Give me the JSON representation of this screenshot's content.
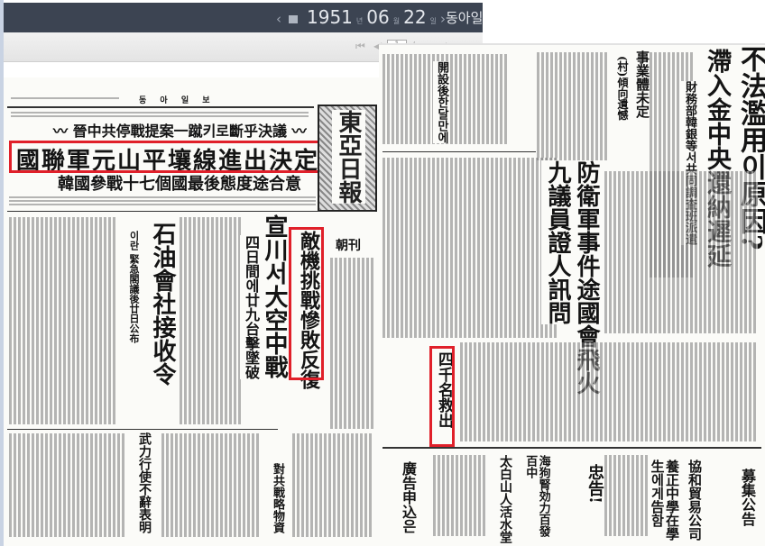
{
  "viewer": {
    "prev_label": "‹",
    "next_label": "›",
    "year": "1951",
    "year_unit": "년",
    "month": "06",
    "month_unit": "월",
    "day": "22",
    "day_unit": "일",
    "newspaper_name": "동아일보",
    "toolbar": {
      "first_page": "⏮",
      "prev_page": "◀",
      "current_page": "1",
      "separator": "/",
      "next_page": "▶",
      "last_page": "⏭"
    }
  },
  "left_page": {
    "masthead": "東亞日報",
    "header_center": "동 아 일 보",
    "kicker": "〰 晉中共停戰提案一蹴키로斷乎決議 〰",
    "banner_headline": "國聯軍元山平壤線進出決定",
    "banner_sub": "韓國參戰十七個國最後態度途合意",
    "edition": "朝刊",
    "articles": [
      {
        "headline": "石油會社接收令",
        "sub": "이란 緊急閣議後廿日公布"
      },
      {
        "headline": "宣川서大空中戰",
        "sub": "四日間에廿九台擊墜破"
      },
      {
        "headline": "敵機挑戰慘敗反復"
      },
      {
        "headline": "武力行使不辭表明"
      },
      {
        "headline": "對共戰略物資"
      }
    ]
  },
  "right_page": {
    "articles": [
      {
        "headline": "不法濫用이原因?"
      },
      {
        "headline": "滯入金中央還納遲延"
      },
      {
        "headline": "財務部韓銀等서共同調査班派遣"
      },
      {
        "headline": "事業體未定"
      },
      {
        "headline": "(村)傾向遺憾"
      },
      {
        "headline": "開設後한달만에"
      },
      {
        "headline": "防衛軍事件途國會飛火"
      },
      {
        "headline": "九議員證人訊問"
      },
      {
        "headline": "四千名救出"
      }
    ],
    "ads": [
      "廣告申込은",
      "太白山人活水堂",
      "海狗腎効力百發百中",
      "忠告!",
      "養正中學在學生에게告함",
      "協和貿易公司",
      "募集公告"
    ]
  }
}
